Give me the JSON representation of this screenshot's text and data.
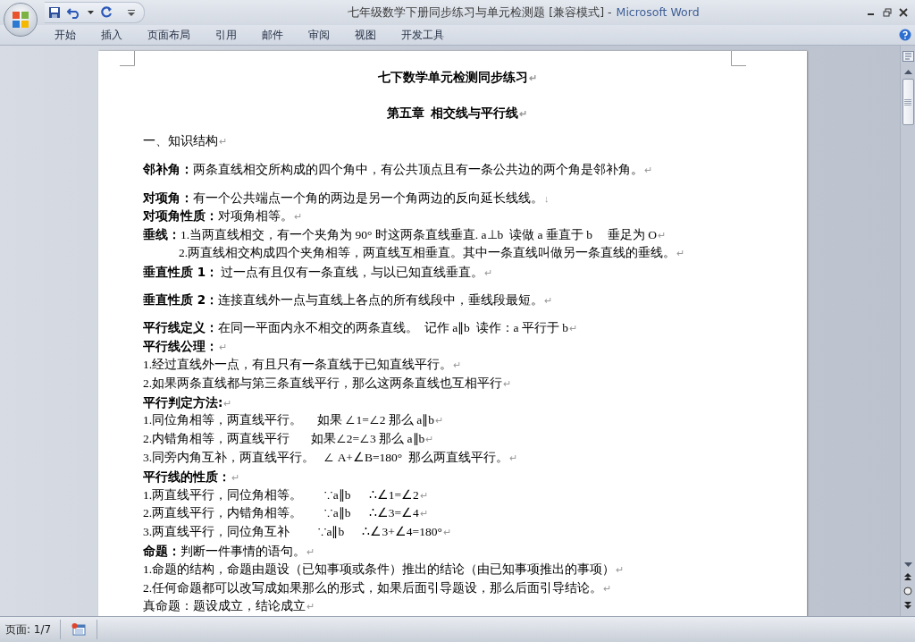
{
  "window": {
    "title": "七年级数学下册同步练习与单元检测题 [兼容模式] -",
    "app_name": "Microsoft Word"
  },
  "ribbon_tabs": [
    "开始",
    "插入",
    "页面布局",
    "引用",
    "邮件",
    "审阅",
    "视图",
    "开发工具"
  ],
  "document": {
    "lines": [
      {
        "kind": "title",
        "text": "七下数学单元检测同步练习",
        "mark": "↵"
      },
      {
        "kind": "heading",
        "text": "第五章  相交线与平行线",
        "mark": "↵"
      },
      {
        "kind": "para",
        "text": "一、知识结构",
        "mark": "↵"
      },
      {
        "kind": "spaced",
        "label": "邻补角：",
        "text": "两条直线相交所构成的四个角中，有公共顶点且有一条公共边的两个角是邻补角。",
        "mark": "↵"
      },
      {
        "kind": "spaced",
        "label": "对项角：",
        "text": "有一个公共端点一个角的两边是另一个角两边的反向延长线线。",
        "mark": "↓"
      },
      {
        "kind": "para",
        "label": "对项角性质：",
        "text": "对项角相等。",
        "mark": "↵"
      },
      {
        "kind": "para",
        "label": "垂线：",
        "text": "1.当两直线相交，有一个夹角为 90° 时这两条直线垂直. a⊥b  读做 a 垂直于 b     垂足为 O",
        "mark": "↵"
      },
      {
        "kind": "indent",
        "text": "2.两直线相交构成四个夹角相等，两直线互相垂直。其中一条直线叫做另一条直线的垂线。",
        "mark": "↵"
      },
      {
        "kind": "para",
        "label": "垂直性质 1：",
        "text": " 过一点有且仅有一条直线，与以已知直线垂直。",
        "mark": "↵"
      },
      {
        "kind": "spaced",
        "label": "垂直性质 2：",
        "text": "连接直线外一点与直线上各点的所有线段中，垂线段最短。",
        "mark": "↵"
      },
      {
        "kind": "spaced",
        "label": "平行线定义：",
        "text": "在同一平面内永不相交的两条直线。  记作 a∥b  读作：a 平行于 b",
        "mark": "↵"
      },
      {
        "kind": "para",
        "label": "平行线公理：",
        "mark": "↵"
      },
      {
        "kind": "para",
        "text": "1.经过直线外一点，有且只有一条直线于已知直线平行。",
        "mark": "↵"
      },
      {
        "kind": "para",
        "text": "2.如果两条直线都与第三条直线平行，那么这两条直线也互相平行",
        "mark": "↵"
      },
      {
        "kind": "para",
        "label": "平行判定方法:",
        "mark": "↵"
      },
      {
        "kind": "para",
        "text": "1.同位角相等，两直线平行。     如果 ∠1=∠2 那么 a∥b",
        "mark": "↵"
      },
      {
        "kind": "para",
        "text": "2.内错角相等，两直线平行       如果∠2=∠3 那么 a∥b",
        "mark": "↵"
      },
      {
        "kind": "para",
        "text": "3.同旁内角互补，两直线平行。   ∠ A+∠B=180°  那么两直线平行。",
        "mark": "↵"
      },
      {
        "kind": "para",
        "label": "平行线的性质：",
        "mark": "↵"
      },
      {
        "kind": "para",
        "text": "1.两直线平行，同位角相等。       ∵a∥b      ∴∠1=∠2",
        "mark": "↵"
      },
      {
        "kind": "para",
        "text": "2.两直线平行，内错角相等。       ∵a∥b      ∴∠3=∠4",
        "mark": "↵"
      },
      {
        "kind": "para",
        "text": "3.两直线平行，同位角互补         ∵a∥b      ∴∠3+∠4=180°",
        "mark": "↵"
      },
      {
        "kind": "para",
        "label": "命题：",
        "text": "判断一件事情的语句。",
        "mark": "↵"
      },
      {
        "kind": "para",
        "text": "1.命题的结构，命题由题设（已知事项或条件）推出的结论（由已知事项推出的事项）",
        "mark": "↵"
      },
      {
        "kind": "para",
        "text": "2.任何命题都可以改写成如果那么的形式，如果后面引导题设，那么后面引导结论。",
        "mark": "↵"
      },
      {
        "kind": "para",
        "text": "真命题：题设成立，结论成立",
        "mark": "↵"
      }
    ]
  },
  "status_bar": {
    "page": "页面: 1/7"
  }
}
